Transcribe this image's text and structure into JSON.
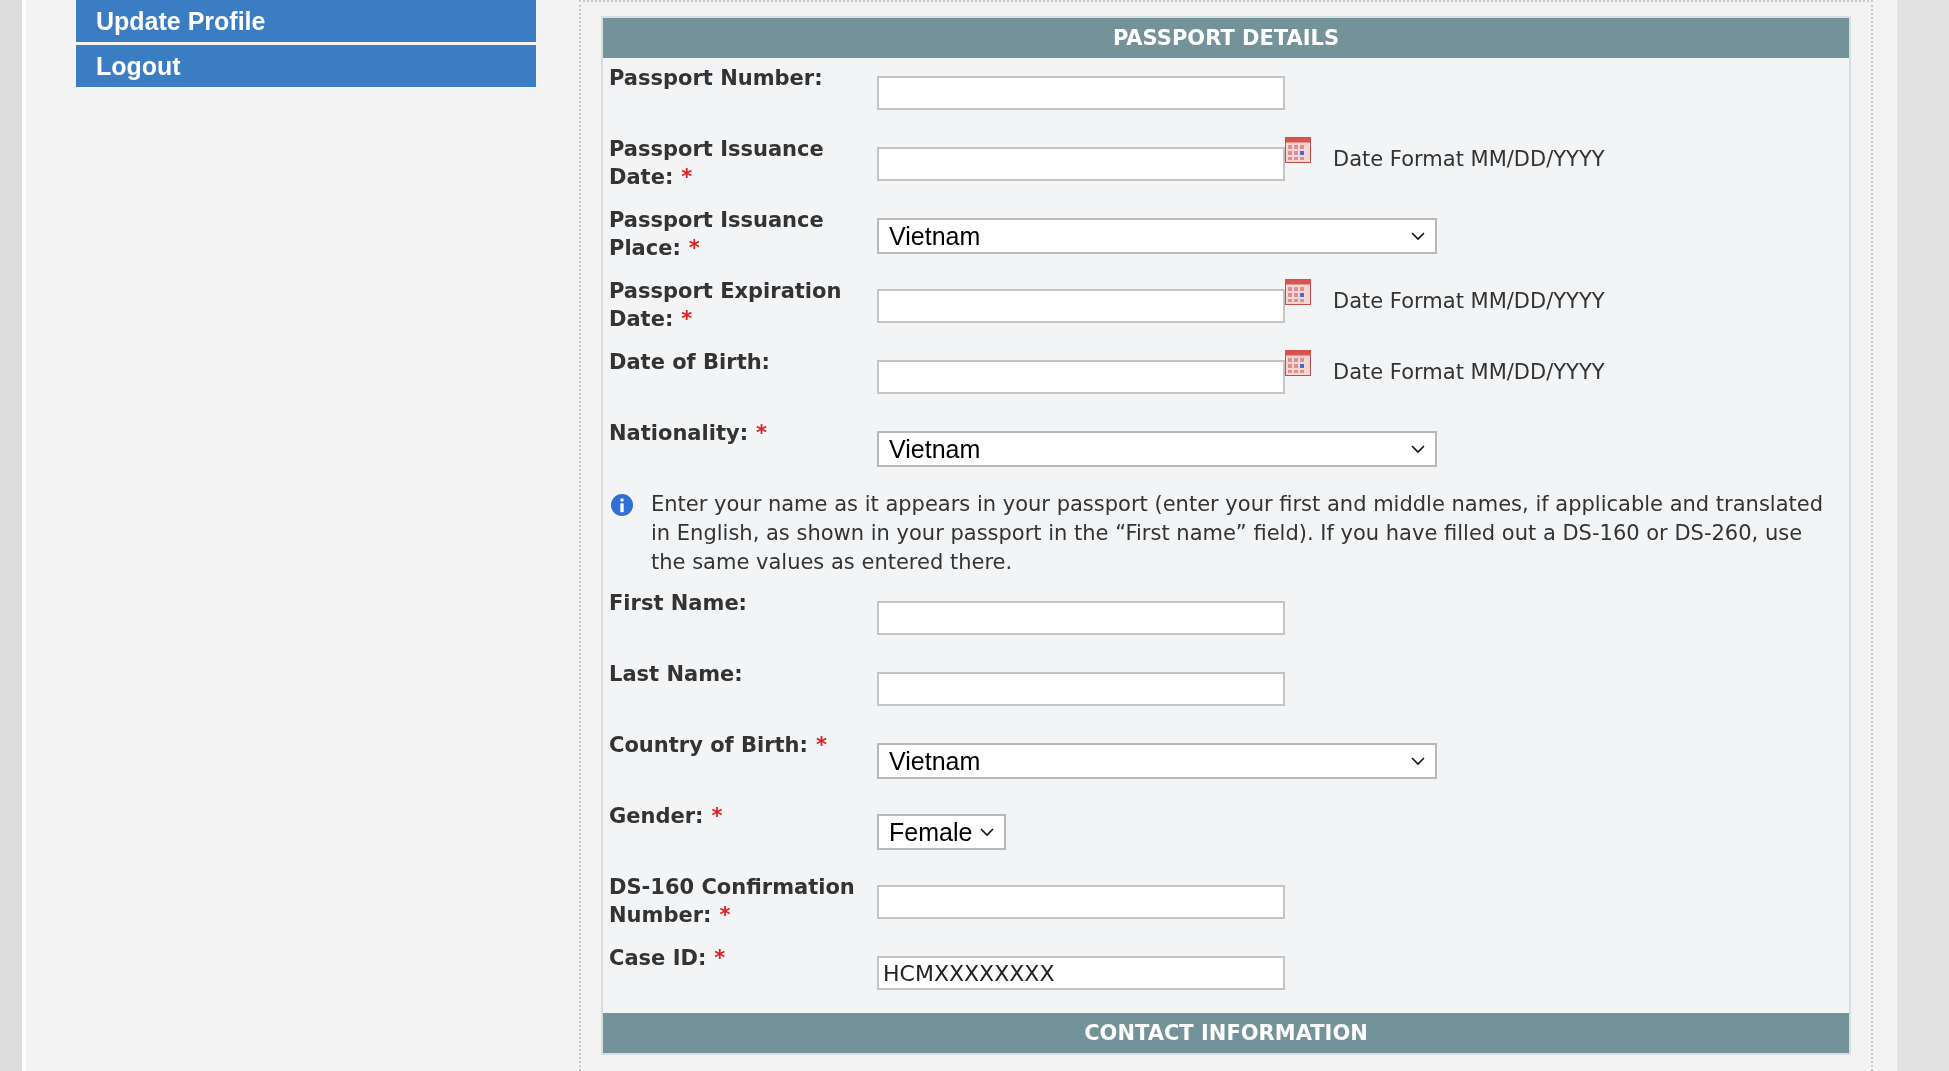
{
  "sidebar": {
    "items": [
      {
        "label": "Update Profile"
      },
      {
        "label": "Logout"
      }
    ]
  },
  "panel": {
    "title": "PASSPORT DETAILS",
    "fields": [
      {
        "kind": "text",
        "label": "Passport Number:"
      },
      {
        "kind": "date",
        "label": "Passport Issuance Date:",
        "marker": "*",
        "hint": "Date Format MM/DD/YYYY"
      },
      {
        "kind": "select",
        "label": "Passport Issuance Place:",
        "marker": "*",
        "value": "Vietnam"
      },
      {
        "kind": "date",
        "label": "Passport Expiration Date:",
        "marker": "*",
        "hint": "Date Format MM/DD/YYYY"
      },
      {
        "kind": "date",
        "label": "Date of Birth:",
        "hint": "Date Format MM/DD/YYYY"
      },
      {
        "kind": "select",
        "label": "Nationality:",
        "marker": "*",
        "value": "Vietnam"
      },
      {
        "kind": "info",
        "text": "Enter your name as it appears in your passport (enter your first and middle names, if applicable and translated in English, as shown in your passport in the “First name” field). If you have filled out a DS-160 or DS-260, use the same values as entered there."
      },
      {
        "kind": "text",
        "label": "First Name:"
      },
      {
        "kind": "text",
        "label": "Last Name:"
      },
      {
        "kind": "select",
        "label": "Country of Birth:",
        "marker": "*",
        "value": "Vietnam"
      },
      {
        "kind": "small-select",
        "label": "Gender:",
        "marker": "*",
        "value": "Female"
      },
      {
        "kind": "text",
        "label": "DS-160 Confirmation Number:",
        "marker": "*"
      },
      {
        "kind": "text",
        "label": "Case ID:",
        "marker": "*",
        "value": "HCMXXXXXXXX"
      }
    ]
  },
  "next_section": {
    "title": "CONTACT INFORMATION"
  }
}
